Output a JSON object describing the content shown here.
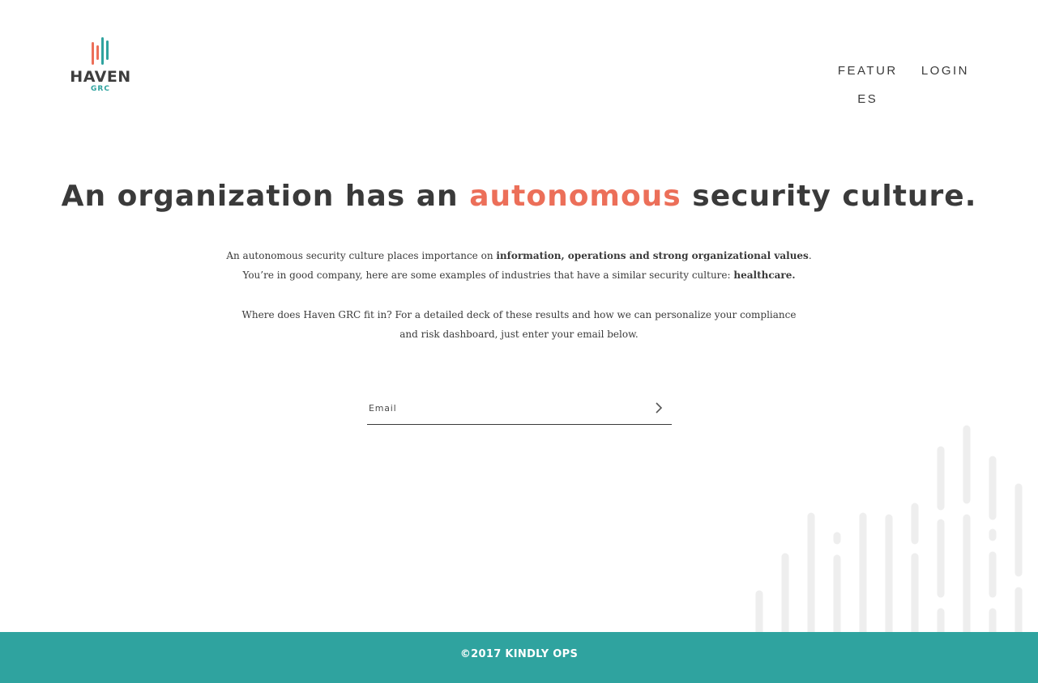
{
  "brand": {
    "name": "HAVEN",
    "sub": "GRC",
    "colors": {
      "coral": "#ec6f59",
      "teal": "#2fa39f",
      "text": "#3a3a3a"
    }
  },
  "nav": {
    "features": "FEATURES",
    "login": "LOGIN"
  },
  "hero": {
    "title_before": "An organization has an ",
    "title_accent": "autonomous",
    "title_after": " security culture."
  },
  "intro": {
    "line1_prefix": "An autonomous security culture places importance on ",
    "line1_bold": "information, operations and strong organizational values",
    "line1_suffix": ".",
    "line2_prefix": "You’re in good company, here are some examples of industries that have a similar security culture: ",
    "line2_bold": "healthcare."
  },
  "cta": {
    "text_line1": "Where does Haven GRC fit in? For a detailed deck of these results and how we can personalize your compliance",
    "text_line2": "and risk dashboard, just enter your email below."
  },
  "email_form": {
    "placeholder": "Email",
    "value": "",
    "submit_icon": "chevron-right-icon"
  },
  "footer": {
    "text": "©2017 KINDLY OPS"
  }
}
